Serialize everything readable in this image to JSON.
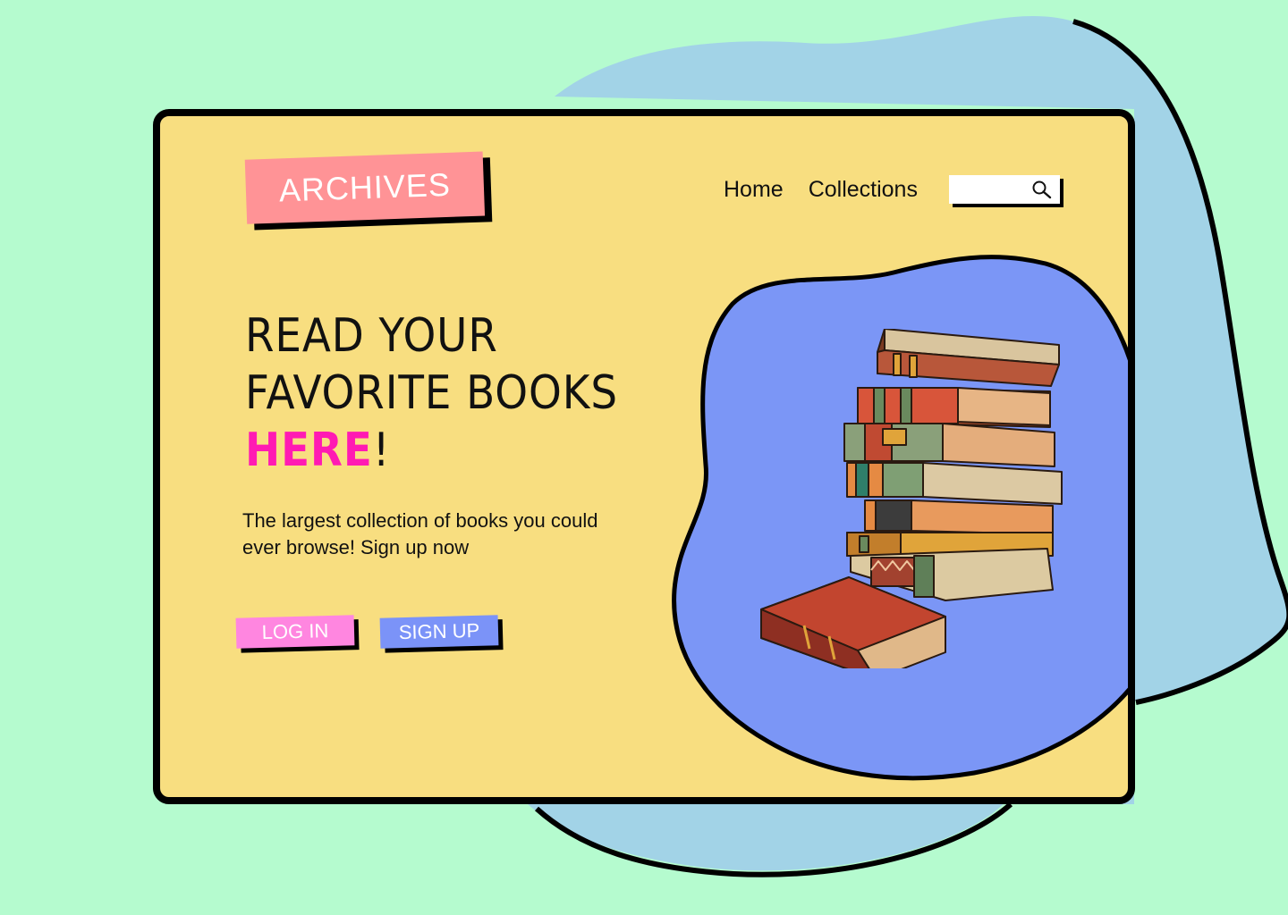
{
  "brand": {
    "logo_text": "ARCHIVES"
  },
  "nav": {
    "items": [
      {
        "label": "Home"
      },
      {
        "label": "Collections"
      }
    ],
    "search": {
      "value": "",
      "icon": "search-icon"
    }
  },
  "hero": {
    "headline_line1": "READ YOUR",
    "headline_line2": "FAVORITE BOOKS",
    "headline_highlight": "HERE",
    "headline_punct": "!",
    "tagline": "The largest collection of books you could ever browse! Sign up now",
    "login_label": "LOG IN",
    "signup_label": "SIGN UP",
    "illustration": "book-stack-illustration"
  },
  "colors": {
    "page_bg": "#b5fbcf",
    "card_bg": "#f8de80",
    "outer_blob": "#a2d3e7",
    "inner_blob": "#7b96f6",
    "logo_bg": "#ff9396",
    "highlight": "#ff1ab3",
    "login_bg": "#ff86e0",
    "signup_bg": "#7b93f8"
  }
}
